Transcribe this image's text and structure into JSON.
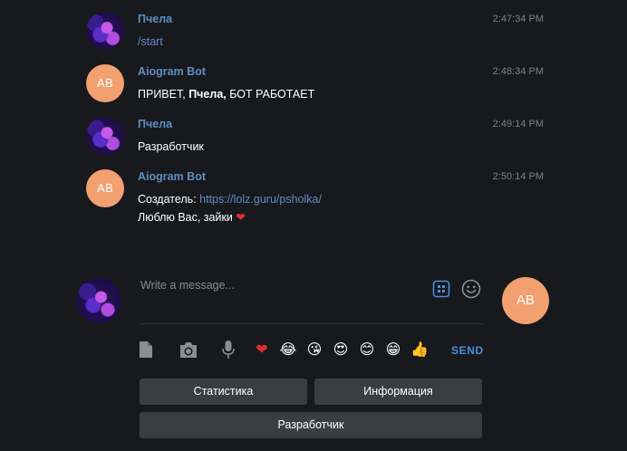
{
  "messages": [
    {
      "author": "Пчела",
      "time": "2:47:34 PM",
      "text": "/start",
      "avatar": "photo"
    },
    {
      "author": "Aiogram Bot",
      "time": "2:48:34 PM",
      "text_prefix": "ПРИВЕТ, ",
      "text_bold": "Пчела,",
      "text_suffix": " БОТ РАБОТАЕТ",
      "avatar": "AB"
    },
    {
      "author": "Пчела",
      "time": "2:49:14 PM",
      "text": "Разработчик",
      "avatar": "photo"
    },
    {
      "author": "Aiogram Bot",
      "time": "2:50:14 PM",
      "line1_label": "Создатель: ",
      "line1_link": "https://lolz.guru/psholka/",
      "line2": "Люблю Вас, зайки ",
      "line2_emoji": "❤",
      "avatar": "AB"
    }
  ],
  "composer": {
    "placeholder": "Write a message...",
    "bot_initials": "AB",
    "send_label": "SEND",
    "emojis": [
      "❤",
      "😂",
      "😘",
      "😍",
      "😊",
      "😁",
      "👍"
    ]
  },
  "keyboard": {
    "buttons": [
      "Статистика",
      "Информация",
      "Разработчик"
    ]
  },
  "colors": {
    "background": "#17191d",
    "accent": "#4a90d9",
    "author": "#5c8fc4",
    "bot_avatar": "#f3a070",
    "keyboard_button": "#3a3d42"
  }
}
